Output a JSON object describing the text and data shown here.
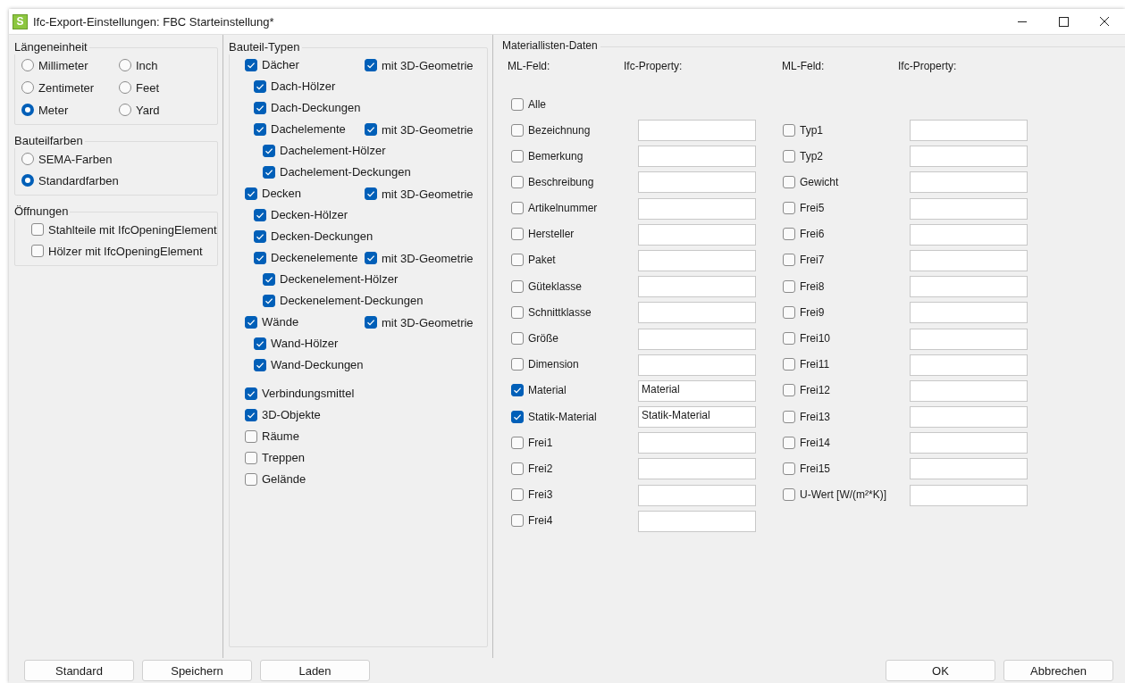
{
  "window": {
    "logo": "S",
    "title": "Ifc-Export-Einstellungen: FBC Starteinstellung*"
  },
  "length_unit": {
    "title": "Längeneinheit",
    "options": [
      {
        "label": "Millimeter",
        "selected": false
      },
      {
        "label": "Inch",
        "selected": false
      },
      {
        "label": "Zentimeter",
        "selected": false
      },
      {
        "label": "Feet",
        "selected": false
      },
      {
        "label": "Meter",
        "selected": true
      },
      {
        "label": "Yard",
        "selected": false
      }
    ]
  },
  "component_colors": {
    "title": "Bauteilfarben",
    "options": [
      {
        "label": "SEMA-Farben",
        "selected": false
      },
      {
        "label": "Standardfarben",
        "selected": true
      }
    ]
  },
  "openings": {
    "title": "Öffnungen",
    "items": [
      {
        "label": "Stahlteile mit IfcOpeningElement",
        "checked": false
      },
      {
        "label": "Hölzer mit IfcOpeningElement",
        "checked": false
      }
    ]
  },
  "component_types": {
    "title": "Bauteil-Typen",
    "structure_items": [
      {
        "label": "Dächer",
        "checked": true,
        "geometry_3d": {
          "label": "mit 3D-Geometrie",
          "checked": true
        },
        "children": [
          {
            "label": "Dach-Hölzer",
            "checked": true
          },
          {
            "label": "Dach-Deckungen",
            "checked": true
          },
          {
            "label": "Dachelemente",
            "checked": true,
            "geometry_3d": {
              "label": "mit 3D-Geometrie",
              "checked": true
            },
            "children": [
              {
                "label": "Dachelement-Hölzer",
                "checked": true
              },
              {
                "label": "Dachelement-Deckungen",
                "checked": true
              }
            ]
          }
        ]
      },
      {
        "label": "Decken",
        "checked": true,
        "geometry_3d": {
          "label": "mit 3D-Geometrie",
          "checked": true
        },
        "children": [
          {
            "label": "Decken-Hölzer",
            "checked": true
          },
          {
            "label": "Decken-Deckungen",
            "checked": true
          },
          {
            "label": "Deckenelemente",
            "checked": true,
            "geometry_3d": {
              "label": "mit 3D-Geometrie",
              "checked": true
            },
            "children": [
              {
                "label": "Deckenelement-Hölzer",
                "checked": true
              },
              {
                "label": "Deckenelement-Deckungen",
                "checked": true
              }
            ]
          }
        ]
      },
      {
        "label": "Wände",
        "checked": true,
        "geometry_3d": {
          "label": "mit 3D-Geometrie",
          "checked": true
        },
        "children": [
          {
            "label": "Wand-Hölzer",
            "checked": true
          },
          {
            "label": "Wand-Deckungen",
            "checked": true
          }
        ]
      }
    ],
    "other_items": [
      {
        "label": "Verbindungsmittel",
        "checked": true
      },
      {
        "label": "3D-Objekte",
        "checked": true
      },
      {
        "label": "Räume",
        "checked": false
      },
      {
        "label": "Treppen",
        "checked": false
      },
      {
        "label": "Gelände",
        "checked": false
      }
    ]
  },
  "material_list": {
    "title": "Materiallisten-Daten",
    "headers": [
      "ML-Feld:",
      "Ifc-Property:",
      "ML-Feld:",
      "Ifc-Property:"
    ],
    "all": {
      "label": "Alle",
      "checked": false
    },
    "left_fields": [
      {
        "label": "Bezeichnung",
        "checked": false
      },
      {
        "label": "Bemerkung",
        "checked": false
      },
      {
        "label": "Beschreibung",
        "checked": false
      },
      {
        "label": "Artikelnummer",
        "checked": false
      },
      {
        "label": "Hersteller",
        "checked": false
      },
      {
        "label": "Paket",
        "checked": false
      },
      {
        "label": "Güteklasse",
        "checked": false
      },
      {
        "label": "Schnittklasse",
        "checked": false
      },
      {
        "label": "Größe",
        "checked": false
      },
      {
        "label": "Dimension",
        "checked": false
      },
      {
        "label": "Material",
        "checked": true,
        "value": "Material"
      },
      {
        "label": "Statik-Material",
        "checked": true,
        "value": "Statik-Material"
      },
      {
        "label": "Frei1",
        "checked": false
      },
      {
        "label": "Frei2",
        "checked": false
      },
      {
        "label": "Frei3",
        "checked": false
      },
      {
        "label": "Frei4",
        "checked": false
      }
    ],
    "right_fields": [
      {
        "label": "Typ1",
        "checked": false
      },
      {
        "label": "Typ2",
        "checked": false
      },
      {
        "label": "Gewicht",
        "checked": false
      },
      {
        "label": "Frei5",
        "checked": false
      },
      {
        "label": "Frei6",
        "checked": false
      },
      {
        "label": "Frei7",
        "checked": false
      },
      {
        "label": "Frei8",
        "checked": false
      },
      {
        "label": "Frei9",
        "checked": false
      },
      {
        "label": "Frei10",
        "checked": false
      },
      {
        "label": "Frei11",
        "checked": false
      },
      {
        "label": "Frei12",
        "checked": false
      },
      {
        "label": "Frei13",
        "checked": false
      },
      {
        "label": "Frei14",
        "checked": false
      },
      {
        "label": "Frei15",
        "checked": false
      },
      {
        "label": "U-Wert [W/(m²*K)]",
        "checked": false
      }
    ]
  },
  "left_buttons": [
    "Standard",
    "Speichern",
    "Laden"
  ],
  "right_buttons": [
    "OK",
    "Abbrechen"
  ]
}
